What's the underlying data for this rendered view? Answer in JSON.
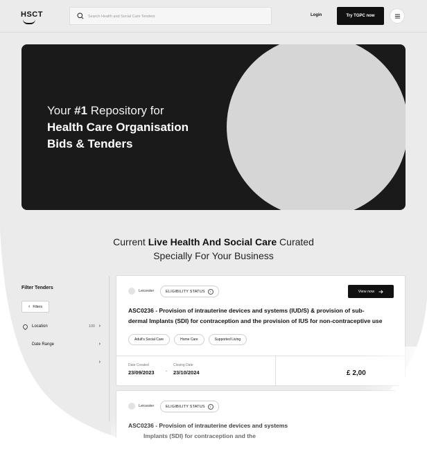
{
  "header": {
    "logo": "HSCT",
    "search_placeholder": "Search Health and Social Care Tenders",
    "login": "Login",
    "cta": "Try TGPC now"
  },
  "hero": {
    "line1_prefix": "Your ",
    "line1_bold": "#1",
    "line1_suffix": " Repository for",
    "line2": "Health Care Organisation",
    "line3": "Bids & Tenders"
  },
  "section": {
    "line1_prefix": "Current ",
    "line1_bold": "Live Health And Social Care",
    "line1_suffix": " Curated",
    "line2": "Specially For Your Business"
  },
  "filters": {
    "title": "Filter Tenders",
    "button": "Filters",
    "rows": [
      {
        "label": "Location",
        "count": "100"
      },
      {
        "label": "Date Range",
        "count": ""
      },
      {
        "label": "",
        "count": ""
      }
    ]
  },
  "cards": [
    {
      "location": "Leicester",
      "status": "ELIGIBILITY STATUS",
      "view_label": "View now",
      "title_line1": "ASC0236 - Provision of intrauterine devices and systems (IUD/S) & provision of sub-",
      "title_line2": "dermal Implants (SDI) for contraception and the provision of IUS for non-contraceptive use",
      "tags": [
        "Adult's Social Care",
        "Home Care",
        "Supported Living"
      ],
      "date_created_label": "Date Created",
      "date_created": "23/09/2023",
      "closing_date_label": "Closing Date",
      "closing_date": "23/10/2024",
      "date_sep": "-",
      "price": "£ 2,00"
    },
    {
      "location": "Leicester",
      "status": "ELIGIBILITY STATUS",
      "title_line1": "ASC0236 - Provision of intrauterine devices and systems",
      "title_line2": "Implants (SDI) for contraception and the"
    }
  ],
  "colors": {
    "page_bg": "#ebebeb",
    "hero_bg": "#1a1a1a",
    "hero_circle": "#d6d6d6",
    "accent": "#111111"
  }
}
